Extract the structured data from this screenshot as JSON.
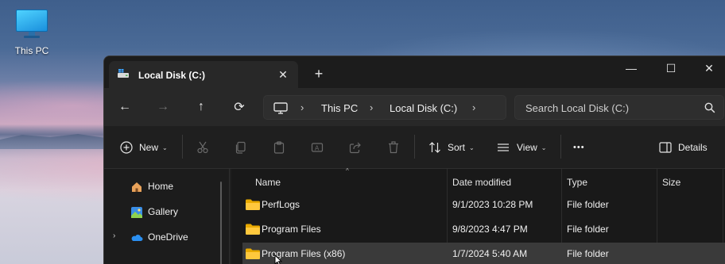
{
  "desktop": {
    "icon_label": "This PC"
  },
  "window": {
    "tab": {
      "title": "Local Disk (C:)",
      "close": "✕"
    },
    "new_tab": "+",
    "controls": {
      "minimize": "—",
      "maximize": "☐",
      "close": "✕"
    }
  },
  "address": {
    "back": "←",
    "forward": "→",
    "up": "↑",
    "refresh": "⟳",
    "breadcrumb": [
      "This PC",
      "Local Disk (C:)"
    ],
    "separator": "›",
    "search_placeholder": "Search Local Disk (C:)"
  },
  "commandbar": {
    "new_label": "New",
    "sort_label": "Sort",
    "view_label": "View",
    "more_label": "•••",
    "details_label": "Details",
    "icons": [
      "cut-icon",
      "copy-icon",
      "paste-icon",
      "rename-icon",
      "share-icon",
      "delete-icon"
    ]
  },
  "navpane": {
    "items": [
      {
        "label": "Home",
        "icon": "home-icon"
      },
      {
        "label": "Gallery",
        "icon": "gallery-icon"
      },
      {
        "label": "OneDrive",
        "icon": "onedrive-icon",
        "expander": "›"
      }
    ]
  },
  "filelist": {
    "columns": {
      "name": "Name",
      "date": "Date modified",
      "type": "Type",
      "size": "Size"
    },
    "sort_indicator": "^",
    "rows": [
      {
        "name": "PerfLogs",
        "date": "9/1/2023 10:28 PM",
        "type": "File folder",
        "size": ""
      },
      {
        "name": "Program Files",
        "date": "9/8/2023 4:47 PM",
        "type": "File folder",
        "size": ""
      },
      {
        "name": "Program Files (x86)",
        "date": "1/7/2024 5:40 AM",
        "type": "File folder",
        "size": ""
      }
    ]
  },
  "colors": {
    "accent": "#4cc2ff",
    "folder": "#ffc83d",
    "window_bg": "#202020"
  }
}
